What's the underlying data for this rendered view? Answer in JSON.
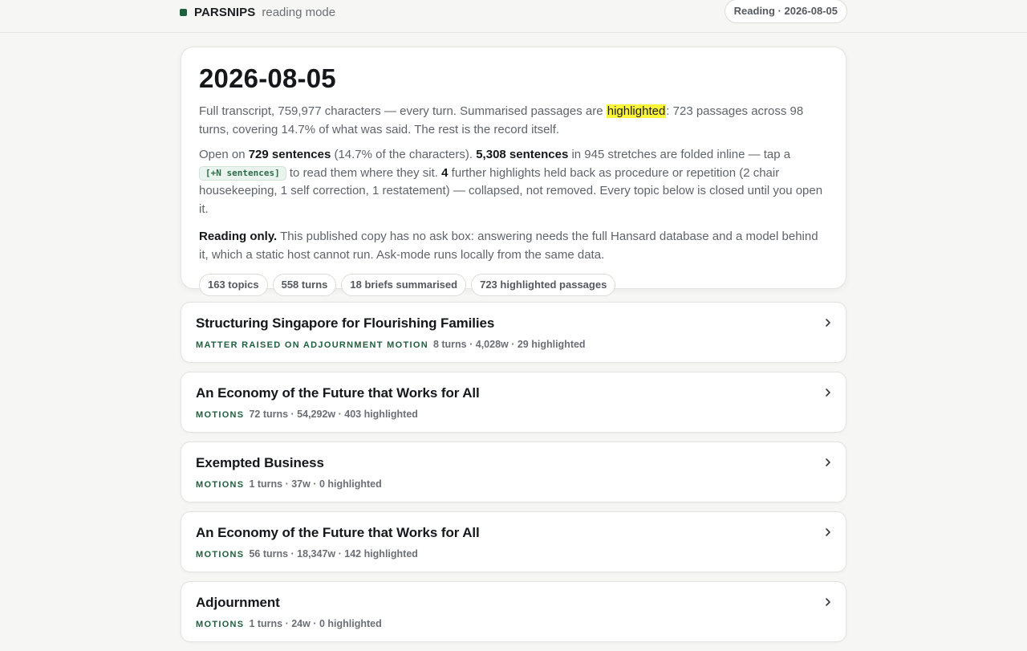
{
  "header": {
    "brand_name": "PARSNIPS",
    "brand_mode": "reading mode",
    "reading_pill": "Reading · 2026-08-05"
  },
  "intro": {
    "title": "2026-08-05",
    "p1_a": "Full transcript, 759,977 characters — every turn. Summarised passages are ",
    "p1_highlight": "highlighted",
    "p1_b": ": 723 passages across 98 turns, covering 14.7% of what was said. The rest is the record itself.",
    "p2_a": "Open on ",
    "p2_b1": "729 sentences",
    "p2_c": " (14.7% of the characters). ",
    "p2_b2": "5,308 sentences",
    "p2_d": " in 945 stretches are folded inline — tap a ",
    "p2_chip": "[+N sentences]",
    "p2_e": " to read them where they sit. ",
    "p2_b3": "4",
    "p2_f": " further highlights held back as procedure or repetition (2 chair housekeeping, 1 self correction, 1 restatement) — collapsed, not removed. Every topic below is closed until you open it.",
    "p3_bold": "Reading only.",
    "p3_rest": " This published copy has no ask box: answering needs the full Hansard database and a model behind it, which a static host cannot run. Ask-mode runs locally from the same data.",
    "stats": [
      "163 topics",
      "558 turns",
      "18 briefs summarised",
      "723 highlighted passages"
    ]
  },
  "topics": [
    {
      "title": "Structuring Singapore for Flourishing Families",
      "kind": "MATTER RAISED ON ADJOURNMENT MOTION",
      "stats": "8 turns · 4,028w · 29 highlighted"
    },
    {
      "title": "An Economy of the Future that Works for All",
      "kind": "MOTIONS",
      "stats": "72 turns · 54,292w · 403 highlighted"
    },
    {
      "title": "Exempted Business",
      "kind": "MOTIONS",
      "stats": "1 turns · 37w · 0 highlighted"
    },
    {
      "title": "An Economy of the Future that Works for All",
      "kind": "MOTIONS",
      "stats": "56 turns · 18,347w · 142 highlighted"
    },
    {
      "title": "Adjournment",
      "kind": "MOTIONS",
      "stats": "1 turns · 24w · 0 highlighted"
    }
  ],
  "colors": {
    "accent": "#1e5f3e",
    "highlight": "#fbf53a"
  },
  "icons": {
    "brand": "square-dot-icon",
    "topic_toggle": "chevron-right-icon"
  }
}
